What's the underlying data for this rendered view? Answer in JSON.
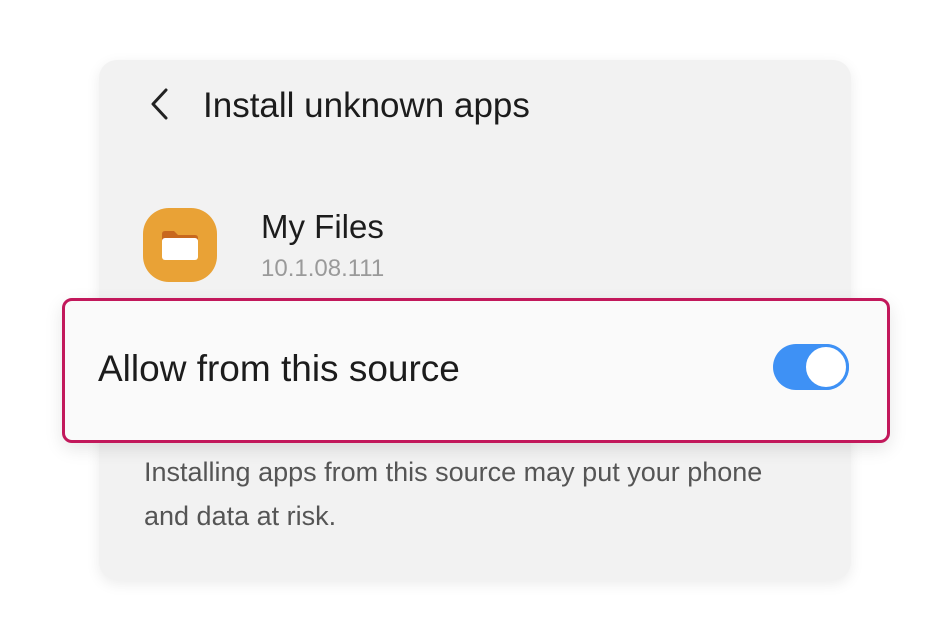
{
  "header": {
    "title": "Install unknown apps",
    "back_icon": "chevron-left-icon"
  },
  "app": {
    "name": "My Files",
    "version": "10.1.08.111",
    "icon": "folder-icon",
    "icon_color": "#e9a236"
  },
  "setting": {
    "label": "Allow from this source",
    "toggle_state": "on",
    "toggle_color": "#3e91f5",
    "highlight_color": "#c2185b"
  },
  "warning": {
    "text": "Installing apps from this source may put your phone and data at risk."
  }
}
